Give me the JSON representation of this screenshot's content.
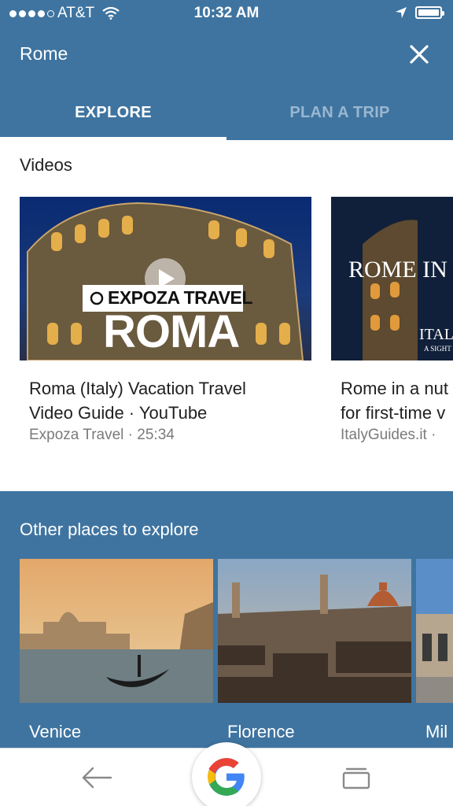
{
  "status_bar": {
    "carrier": "AT&T",
    "time": "10:32 AM"
  },
  "app_bar": {
    "title": "Rome"
  },
  "tabs": [
    {
      "label": "EXPLORE"
    },
    {
      "label": "PLAN A TRIP"
    }
  ],
  "videos": {
    "heading": "Videos",
    "items": [
      {
        "title_line1": "Roma (Italy) Vacation Travel",
        "title_line2": "Video Guide · YouTube",
        "subtitle": "Expoza Travel · 25:34",
        "thumb_brand": "EXPOZA TRAVEL",
        "thumb_title": "ROMA"
      },
      {
        "title_line1": "Rome in a nut",
        "title_line2": "for first-time v",
        "subtitle": "ItalyGuides.it ·",
        "thumb_title": "ROME IN",
        "thumb_sub": "ITAL",
        "thumb_small": "A SIGHT"
      }
    ]
  },
  "places": {
    "heading": "Other places to explore",
    "items": [
      {
        "name": "Venice"
      },
      {
        "name": "Florence"
      },
      {
        "name": "Mil"
      }
    ]
  },
  "colors": {
    "primary": "#3f74a0",
    "inactive_tab": "#9ab7d0"
  }
}
